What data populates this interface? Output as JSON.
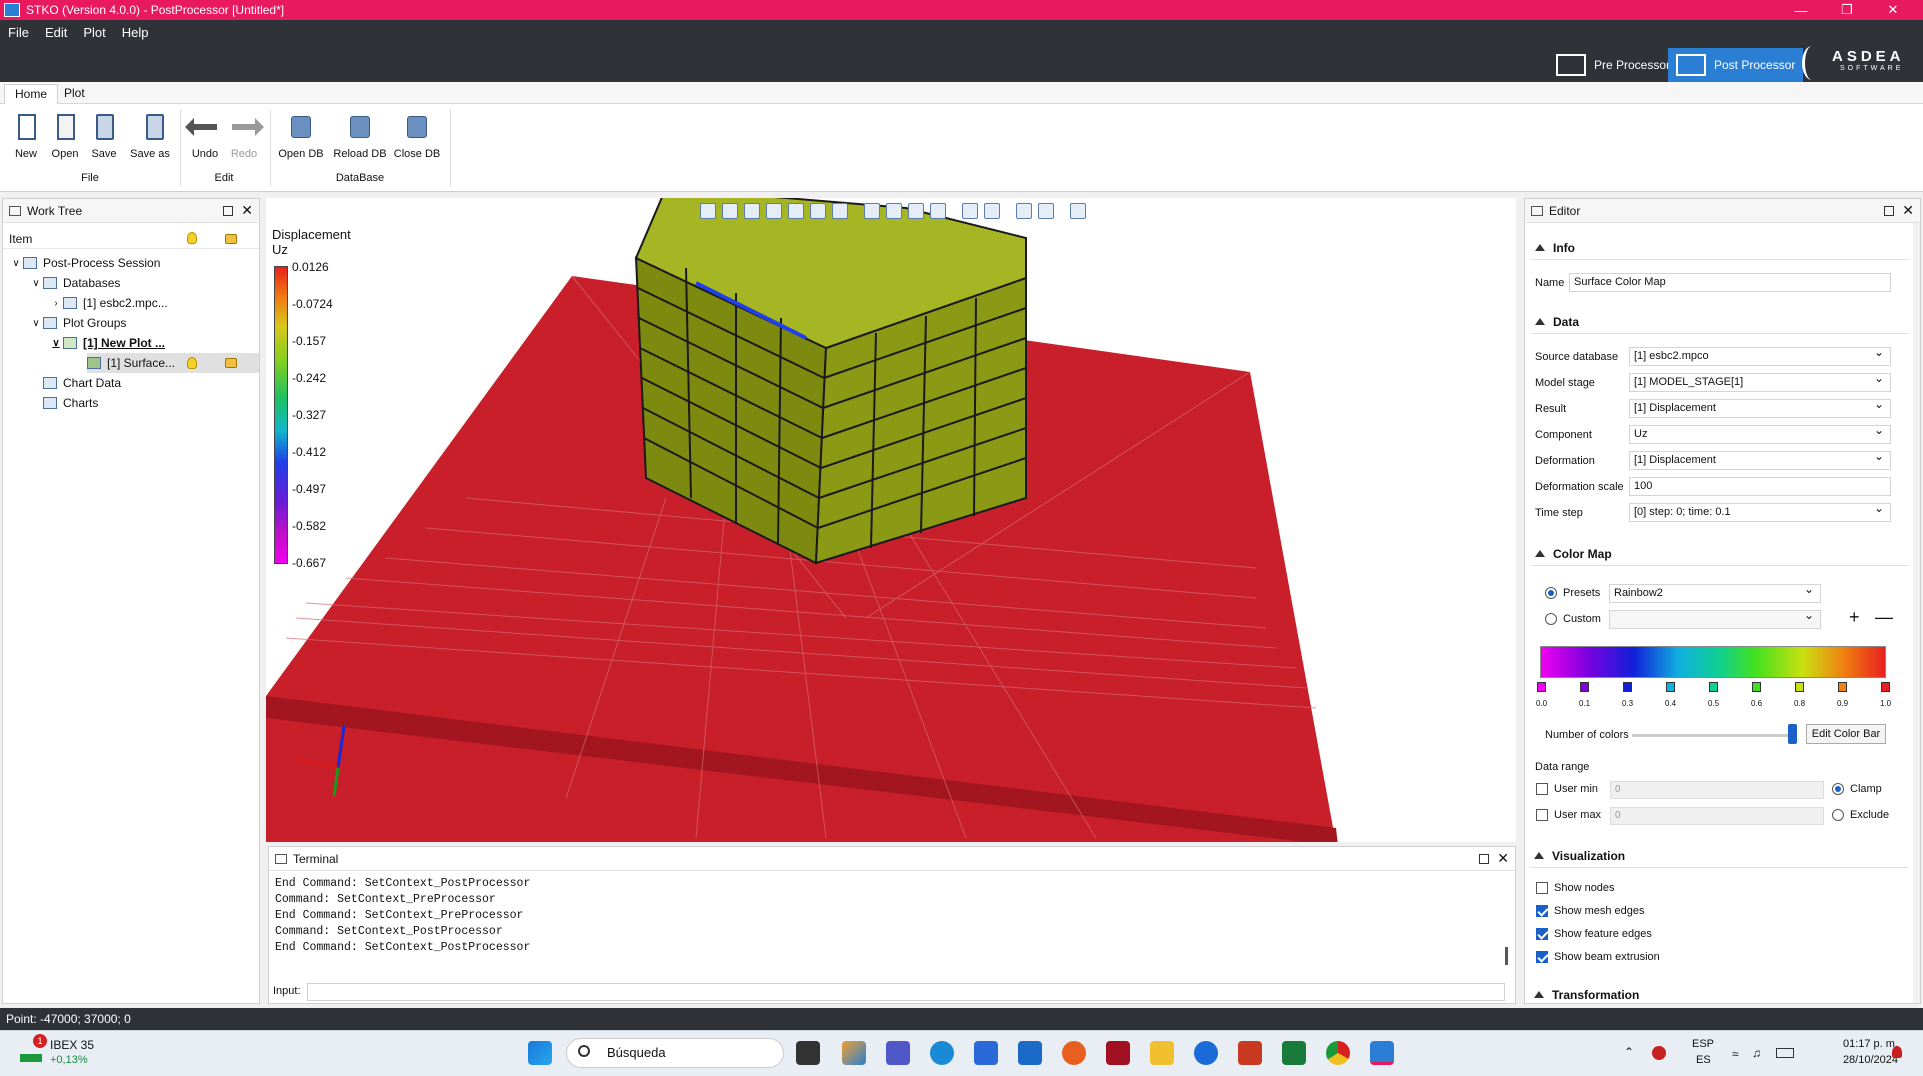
{
  "window": {
    "title": "STKO (Version 4.0.0) - PostProcessor [Untitled*]"
  },
  "menu": [
    "File",
    "Edit",
    "Plot",
    "Help"
  ],
  "switches": {
    "pre": "Pre Processor",
    "post": "Post Processor"
  },
  "logo": "ASDEA",
  "logo_sub": "SOFTWARE",
  "ribbon": {
    "tabs": [
      "Home",
      "Plot"
    ],
    "buttons": {
      "new": "New",
      "open": "Open",
      "save": "Save",
      "save_as": "Save as",
      "undo": "Undo",
      "redo": "Redo",
      "open_db": "Open DB",
      "reload_db": "Reload DB",
      "close_db": "Close DB"
    },
    "groups": {
      "file": "File",
      "edit": "Edit",
      "database": "DataBase"
    }
  },
  "worktree": {
    "title": "Work Tree",
    "column": "Item",
    "items": [
      "Post-Process Session",
      "Databases",
      "[1] esbc2.mpc...",
      "Plot Groups",
      "[1] New Plot ...",
      "[1] Surface...",
      "Chart Data",
      "Charts"
    ]
  },
  "legend": {
    "title1": "Displacement",
    "title2": "Uz",
    "ticks": [
      "0.0126",
      "-0.0724",
      "-0.157",
      "-0.242",
      "-0.327",
      "-0.412",
      "-0.497",
      "-0.582",
      "-0.667"
    ]
  },
  "terminal": {
    "title": "Terminal",
    "lines": [
      "End Command: SetContext_PostProcessor",
      "Command: SetContext_PreProcessor",
      "End Command: SetContext_PreProcessor",
      "Command: SetContext_PostProcessor",
      "End Command: SetContext_PostProcessor"
    ],
    "input_label": "Input:"
  },
  "editor": {
    "title": "Editor",
    "sections": {
      "info": "Info",
      "data": "Data",
      "colormap": "Color Map",
      "visualization": "Visualization",
      "transformation": "Transformation"
    },
    "name_label": "Name",
    "name_value": "Surface Color Map",
    "data_fields": [
      {
        "label": "Source database",
        "value": "[1] esbc2.mpco"
      },
      {
        "label": "Model stage",
        "value": "[1] MODEL_STAGE[1]"
      },
      {
        "label": "Result",
        "value": "[1] Displacement"
      },
      {
        "label": "Component",
        "value": "Uz"
      },
      {
        "label": "Deformation",
        "value": "[1] Displacement"
      },
      {
        "label": "Deformation scale",
        "value": "100"
      },
      {
        "label": "Time step",
        "value": "[0] step: 0; time: 0.1"
      }
    ],
    "presets_label": "Presets",
    "presets_value": "Rainbow2",
    "custom_label": "Custom",
    "stops": [
      "0.0",
      "0.1",
      "0.3",
      "0.4",
      "0.5",
      "0.6",
      "0.8",
      "0.9",
      "1.0"
    ],
    "num_colors_label": "Number of colors",
    "edit_colorbar": "Edit Color Bar",
    "data_range": "Data range",
    "user_min": "User min",
    "user_max": "User max",
    "min_value": "0",
    "max_value": "0",
    "clamp": "Clamp",
    "exclude": "Exclude",
    "vis": [
      "Show nodes",
      "Show mesh edges",
      "Show feature edges",
      "Show beam extrusion"
    ]
  },
  "status": "Point: -47000; 37000; 0",
  "taskbar": {
    "ibex_name": "IBEX 35",
    "ibex_change": "+0,13%",
    "ibex_badge": "1",
    "search": "Búsqueda",
    "lang1": "ESP",
    "lang2": "ES",
    "time": "01:17 p. m.",
    "date": "28/10/2024"
  }
}
